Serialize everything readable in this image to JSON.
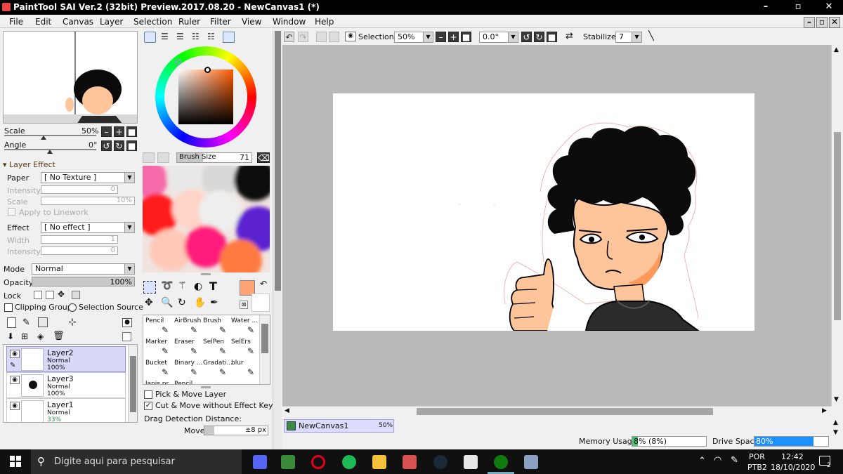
{
  "window": {
    "title": "PaintTool SAI Ver.2 (32bit) Preview.2017.08.20 - NewCanvas1 (*)",
    "min": "–",
    "max": "▫",
    "close": "✕",
    "inner_min": "–",
    "inner_max": "▫",
    "inner_close": "✕"
  },
  "menu": [
    "File",
    "Edit",
    "Canvas",
    "Layer",
    "Selection",
    "Ruler",
    "Filter",
    "View",
    "Window",
    "Help"
  ],
  "navigator": {
    "scale_label": "Scale",
    "scale_value": "50%",
    "angle_label": "Angle",
    "angle_value": "0°"
  },
  "layer_effect": {
    "header": "Layer Effect",
    "paper_label": "Paper",
    "paper_value": "[ No Texture ]",
    "intensity_label": "Intensity",
    "intensity_value": "0",
    "scale_label": "Scale",
    "scale_value": "10%",
    "apply_label": "Apply to Linework",
    "effect_label": "Effect",
    "effect_value": "[ No effect ]",
    "width_label": "Width",
    "width_value": "1",
    "intensity2_label": "Intensity",
    "intensity2_value": "0"
  },
  "layer_props": {
    "mode_label": "Mode",
    "mode_value": "Normal",
    "opacity_label": "Opacity",
    "opacity_value": "100%",
    "opacity_fraction": 1.0,
    "lock_label": "Lock",
    "clipping_label": "Clipping Group",
    "selection_source_label": "Selection Source"
  },
  "layers": [
    {
      "name": "Layer2",
      "mode": "Normal",
      "opacity": "100%"
    },
    {
      "name": "Layer3",
      "mode": "Normal",
      "opacity": "100%"
    },
    {
      "name": "Layer1",
      "mode": "Normal",
      "opacity": "33%"
    }
  ],
  "brush": {
    "size_label": "Brush Size",
    "size_value": "71",
    "size_fraction": 0.35
  },
  "tools": [
    [
      "Pencil",
      "AirBrush",
      "Brush",
      "Water ..."
    ],
    [
      "Marker",
      "Eraser",
      "SelPen",
      "SelErs"
    ],
    [
      "Bucket",
      "Binary ...",
      "Gradati...",
      "blur"
    ],
    [
      "lapis pr...",
      "Pencil",
      "",
      ""
    ]
  ],
  "tool_options": {
    "pick_move_label": "Pick & Move Layer",
    "cut_move_label": "Cut & Move without Effect Key",
    "drag_label": "Drag Detection Distance:",
    "move_label": "Move",
    "move_value": "±8 px"
  },
  "canvas_toolbar": {
    "selection_label": "Selection",
    "zoom_value": "50%",
    "angle_value": "0.0°",
    "stabilizer_label": "Stabilizer",
    "stabilizer_value": "7"
  },
  "doc_tab": {
    "name": "NewCanvas1",
    "zoom": "50%"
  },
  "status": {
    "memory_label": "Memory Usage",
    "memory_value": "8% (8%)",
    "memory_fraction": 0.08,
    "drive_label": "Drive Space",
    "drive_value": "80%",
    "drive_fraction": 0.8
  },
  "taskbar": {
    "search_placeholder": "Digite aqui para pesquisar",
    "lang1": "POR",
    "lang2": "PTB2",
    "time": "12:42",
    "date": "18/10/2020",
    "notif_count": "2"
  },
  "colors": {
    "current_color": "#ffa477",
    "skin": "#ffc59a",
    "hair": "#0b0b0b",
    "accent_blue": "#1e90ff"
  }
}
